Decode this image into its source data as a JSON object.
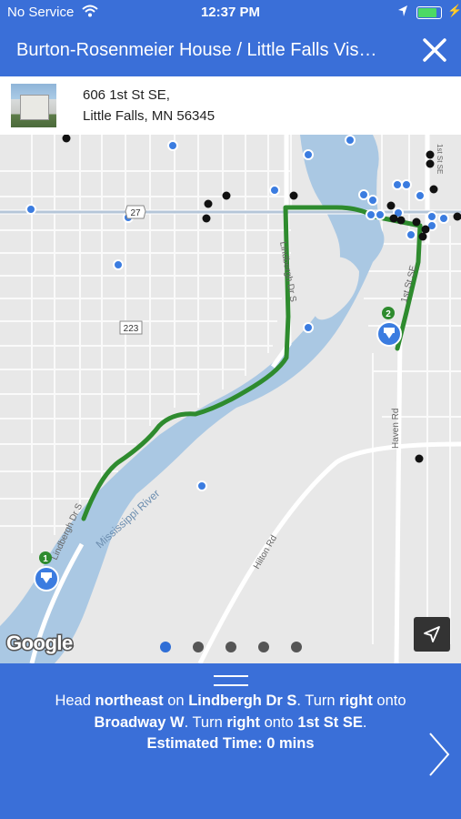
{
  "status_bar": {
    "carrier": "No Service",
    "time": "12:37 PM",
    "battery_level": 0.9
  },
  "header": {
    "title": "Burton-Rosenmeier House / Little Falls Vis…"
  },
  "address": {
    "line1": "606 1st St SE,",
    "line2": "Little Falls, MN 56345"
  },
  "map": {
    "labels": {
      "river": "Mississippi River",
      "road_lindbergh_upper": "Lindbergh Dr S",
      "road_lindbergh_lower": "Lindbergh Dr S",
      "road_1st": "1st St SE",
      "road_haven": "Haven Rd",
      "road_hilton": "Hilton Rd",
      "road_1st_top": "1st St SE",
      "shield_27": "27",
      "shield_223": "223"
    },
    "markers": [
      {
        "number": "1"
      },
      {
        "number": "2"
      }
    ],
    "attribution": "Google",
    "route_color": "#2e8b2e",
    "page_dots": {
      "count": 5,
      "active": 0
    }
  },
  "directions": {
    "parts": [
      {
        "text": "Head ",
        "bold": false
      },
      {
        "text": "northeast",
        "bold": true
      },
      {
        "text": " on ",
        "bold": false
      },
      {
        "text": "Lindbergh Dr S",
        "bold": true
      },
      {
        "text": ". Turn ",
        "bold": false
      },
      {
        "text": "right",
        "bold": true
      },
      {
        "text": " onto ",
        "bold": false
      },
      {
        "text": "Broadway W",
        "bold": true
      },
      {
        "text": ". Turn ",
        "bold": false
      },
      {
        "text": "right",
        "bold": true
      },
      {
        "text": " onto ",
        "bold": false
      },
      {
        "text": "1st St SE",
        "bold": true
      },
      {
        "text": ".",
        "bold": false
      }
    ],
    "estimated_time": "Estimated Time: 0 mins"
  },
  "colors": {
    "brand_blue": "#3a6fd8",
    "water": "#aac8e3",
    "land": "#e8e8e8"
  }
}
